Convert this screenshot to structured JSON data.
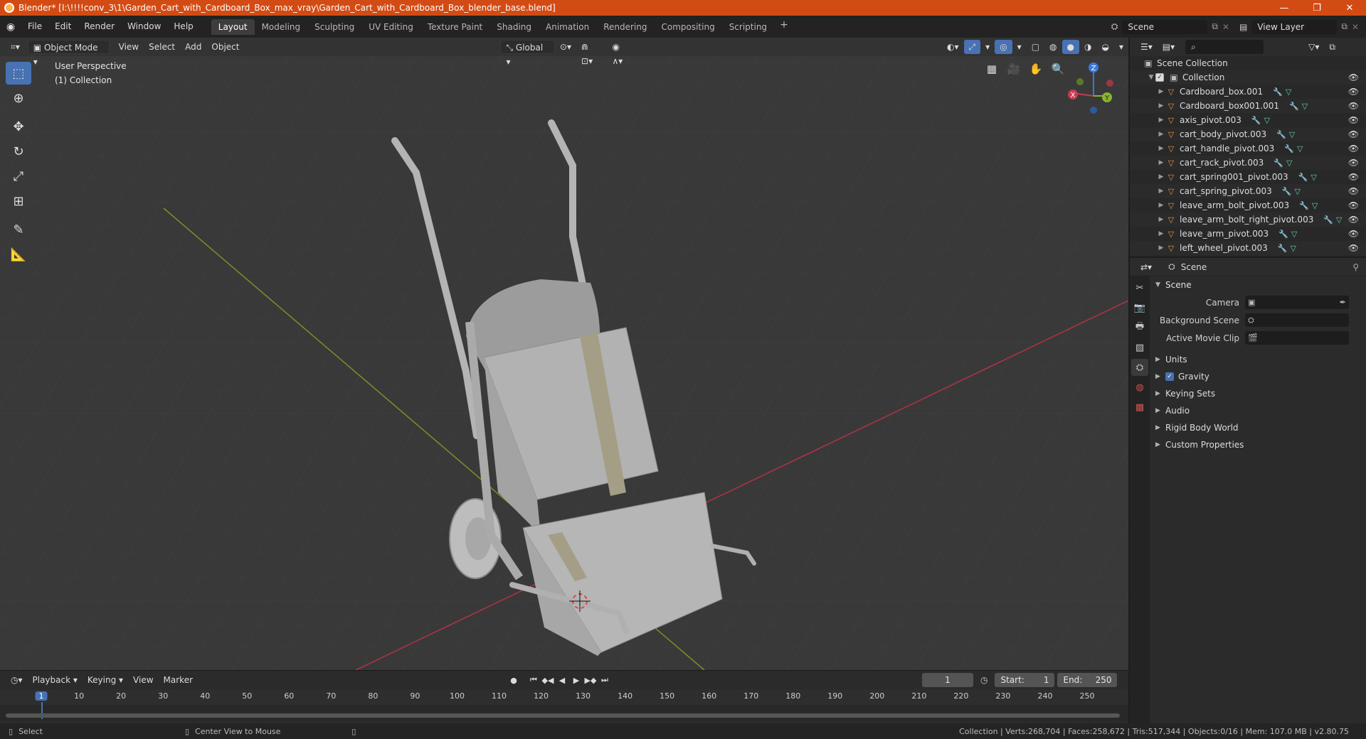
{
  "window": {
    "title": "Blender* [I:\\!!!!conv_3\\1\\Garden_Cart_with_Cardboard_Box_max_vray\\Garden_Cart_with_Cardboard_Box_blender_base.blend]",
    "minimize": "—",
    "maximize": "❐",
    "close": "✕"
  },
  "menu": {
    "items": [
      "File",
      "Edit",
      "Render",
      "Window",
      "Help"
    ]
  },
  "workspaces": {
    "tabs": [
      "Layout",
      "Modeling",
      "Sculpting",
      "UV Editing",
      "Texture Paint",
      "Shading",
      "Animation",
      "Rendering",
      "Compositing",
      "Scripting"
    ],
    "active": "Layout",
    "add": "+"
  },
  "top_right": {
    "scene": "Scene",
    "view_layer": "View Layer"
  },
  "viewport": {
    "mode": "Object Mode",
    "menus": [
      "View",
      "Select",
      "Add",
      "Object"
    ],
    "orientation": "Global",
    "perspective_label": "User Perspective",
    "collection_label": "(1) Collection",
    "gizmo": {
      "x": "X",
      "y": "Y",
      "z": "Z"
    }
  },
  "timeline": {
    "menus": [
      "Playback",
      "Keying",
      "View",
      "Marker"
    ],
    "current_frame": "1",
    "start_label": "Start:",
    "start": "1",
    "end_label": "End:",
    "end": "250",
    "ruler": [
      "1",
      "10",
      "20",
      "30",
      "40",
      "50",
      "60",
      "70",
      "80",
      "90",
      "100",
      "110",
      "120",
      "130",
      "140",
      "150",
      "160",
      "170",
      "180",
      "190",
      "200",
      "210",
      "220",
      "230",
      "240",
      "250"
    ]
  },
  "statusbar": {
    "left_action": "Select",
    "mid_action": "Center View to Mouse",
    "stats": "Collection | Verts:268,704 | Faces:258,672 | Tris:517,344 | Objects:0/16 | Mem: 107.0 MB | v2.80.75"
  },
  "outliner": {
    "root": "Scene Collection",
    "collection": "Collection",
    "objects": [
      "Cardboard_box.001",
      "Cardboard_box001.001",
      "axis_pivot.003",
      "cart_body_pivot.003",
      "cart_handle_pivot.003",
      "cart_rack_pivot.003",
      "cart_spring001_pivot.003",
      "cart_spring_pivot.003",
      "leave_arm_bolt_pivot.003",
      "leave_arm_bolt_right_pivot.003",
      "leave_arm_pivot.003",
      "left_wheel_pivot.003"
    ]
  },
  "properties": {
    "context": "Scene",
    "panel": "Scene",
    "fields": [
      {
        "label": "Camera"
      },
      {
        "label": "Background Scene"
      },
      {
        "label": "Active Movie Clip"
      }
    ],
    "subpanels": {
      "units": "Units",
      "gravity": "Gravity",
      "keying_sets": "Keying Sets",
      "audio": "Audio",
      "rigid_body": "Rigid Body World",
      "custom": "Custom Properties"
    }
  },
  "colors": {
    "titlebar": "#d34b14",
    "accent": "#4772b3",
    "object_icon": "#e8933f",
    "x_axis": "#c83c50",
    "y_axis": "#8ab42e",
    "z_axis": "#3c78d8"
  },
  "icons": {
    "app": "blender-icon",
    "object": "mesh-object-icon",
    "modifier": "wrench-icon",
    "mesh": "mesh-data-icon",
    "visibility": "eye-icon"
  }
}
